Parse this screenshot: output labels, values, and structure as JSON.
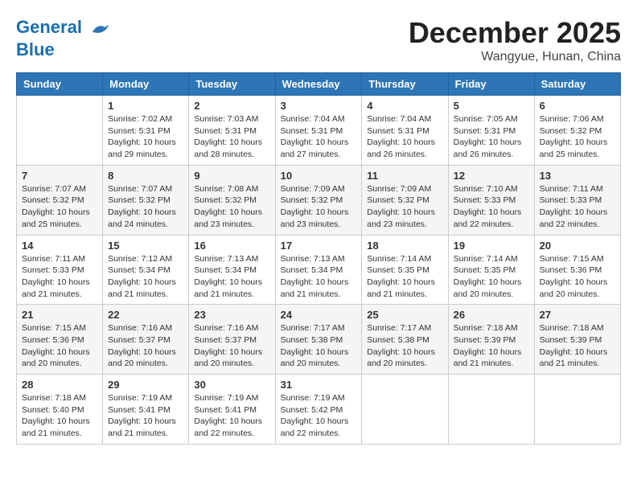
{
  "header": {
    "logo_line1": "General",
    "logo_line2": "Blue",
    "month": "December 2025",
    "location": "Wangyue, Hunan, China"
  },
  "weekdays": [
    "Sunday",
    "Monday",
    "Tuesday",
    "Wednesday",
    "Thursday",
    "Friday",
    "Saturday"
  ],
  "weeks": [
    [
      {
        "day": "",
        "info": ""
      },
      {
        "day": "1",
        "info": "Sunrise: 7:02 AM\nSunset: 5:31 PM\nDaylight: 10 hours\nand 29 minutes."
      },
      {
        "day": "2",
        "info": "Sunrise: 7:03 AM\nSunset: 5:31 PM\nDaylight: 10 hours\nand 28 minutes."
      },
      {
        "day": "3",
        "info": "Sunrise: 7:04 AM\nSunset: 5:31 PM\nDaylight: 10 hours\nand 27 minutes."
      },
      {
        "day": "4",
        "info": "Sunrise: 7:04 AM\nSunset: 5:31 PM\nDaylight: 10 hours\nand 26 minutes."
      },
      {
        "day": "5",
        "info": "Sunrise: 7:05 AM\nSunset: 5:31 PM\nDaylight: 10 hours\nand 26 minutes."
      },
      {
        "day": "6",
        "info": "Sunrise: 7:06 AM\nSunset: 5:32 PM\nDaylight: 10 hours\nand 25 minutes."
      }
    ],
    [
      {
        "day": "7",
        "info": "Sunrise: 7:07 AM\nSunset: 5:32 PM\nDaylight: 10 hours\nand 25 minutes."
      },
      {
        "day": "8",
        "info": "Sunrise: 7:07 AM\nSunset: 5:32 PM\nDaylight: 10 hours\nand 24 minutes."
      },
      {
        "day": "9",
        "info": "Sunrise: 7:08 AM\nSunset: 5:32 PM\nDaylight: 10 hours\nand 23 minutes."
      },
      {
        "day": "10",
        "info": "Sunrise: 7:09 AM\nSunset: 5:32 PM\nDaylight: 10 hours\nand 23 minutes."
      },
      {
        "day": "11",
        "info": "Sunrise: 7:09 AM\nSunset: 5:32 PM\nDaylight: 10 hours\nand 23 minutes."
      },
      {
        "day": "12",
        "info": "Sunrise: 7:10 AM\nSunset: 5:33 PM\nDaylight: 10 hours\nand 22 minutes."
      },
      {
        "day": "13",
        "info": "Sunrise: 7:11 AM\nSunset: 5:33 PM\nDaylight: 10 hours\nand 22 minutes."
      }
    ],
    [
      {
        "day": "14",
        "info": "Sunrise: 7:11 AM\nSunset: 5:33 PM\nDaylight: 10 hours\nand 21 minutes."
      },
      {
        "day": "15",
        "info": "Sunrise: 7:12 AM\nSunset: 5:34 PM\nDaylight: 10 hours\nand 21 minutes."
      },
      {
        "day": "16",
        "info": "Sunrise: 7:13 AM\nSunset: 5:34 PM\nDaylight: 10 hours\nand 21 minutes."
      },
      {
        "day": "17",
        "info": "Sunrise: 7:13 AM\nSunset: 5:34 PM\nDaylight: 10 hours\nand 21 minutes."
      },
      {
        "day": "18",
        "info": "Sunrise: 7:14 AM\nSunset: 5:35 PM\nDaylight: 10 hours\nand 21 minutes."
      },
      {
        "day": "19",
        "info": "Sunrise: 7:14 AM\nSunset: 5:35 PM\nDaylight: 10 hours\nand 20 minutes."
      },
      {
        "day": "20",
        "info": "Sunrise: 7:15 AM\nSunset: 5:36 PM\nDaylight: 10 hours\nand 20 minutes."
      }
    ],
    [
      {
        "day": "21",
        "info": "Sunrise: 7:15 AM\nSunset: 5:36 PM\nDaylight: 10 hours\nand 20 minutes."
      },
      {
        "day": "22",
        "info": "Sunrise: 7:16 AM\nSunset: 5:37 PM\nDaylight: 10 hours\nand 20 minutes."
      },
      {
        "day": "23",
        "info": "Sunrise: 7:16 AM\nSunset: 5:37 PM\nDaylight: 10 hours\nand 20 minutes."
      },
      {
        "day": "24",
        "info": "Sunrise: 7:17 AM\nSunset: 5:38 PM\nDaylight: 10 hours\nand 20 minutes."
      },
      {
        "day": "25",
        "info": "Sunrise: 7:17 AM\nSunset: 5:38 PM\nDaylight: 10 hours\nand 20 minutes."
      },
      {
        "day": "26",
        "info": "Sunrise: 7:18 AM\nSunset: 5:39 PM\nDaylight: 10 hours\nand 21 minutes."
      },
      {
        "day": "27",
        "info": "Sunrise: 7:18 AM\nSunset: 5:39 PM\nDaylight: 10 hours\nand 21 minutes."
      }
    ],
    [
      {
        "day": "28",
        "info": "Sunrise: 7:18 AM\nSunset: 5:40 PM\nDaylight: 10 hours\nand 21 minutes."
      },
      {
        "day": "29",
        "info": "Sunrise: 7:19 AM\nSunset: 5:41 PM\nDaylight: 10 hours\nand 21 minutes."
      },
      {
        "day": "30",
        "info": "Sunrise: 7:19 AM\nSunset: 5:41 PM\nDaylight: 10 hours\nand 22 minutes."
      },
      {
        "day": "31",
        "info": "Sunrise: 7:19 AM\nSunset: 5:42 PM\nDaylight: 10 hours\nand 22 minutes."
      },
      {
        "day": "",
        "info": ""
      },
      {
        "day": "",
        "info": ""
      },
      {
        "day": "",
        "info": ""
      }
    ]
  ]
}
